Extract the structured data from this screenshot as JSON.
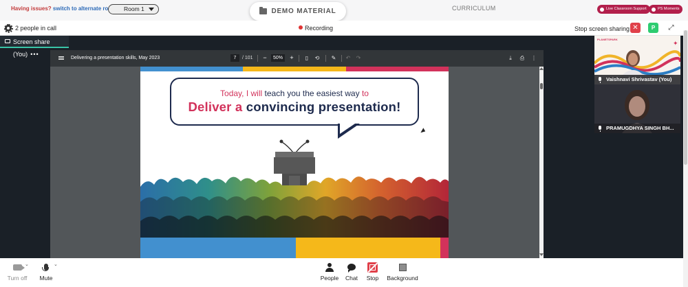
{
  "topbar": {
    "issues_text": "Having issues?",
    "alt_link": "switch to alternate room",
    "room_value": "Room 1",
    "demo_tab_label": "DEMO MATERIAL",
    "curriculum_label": "CURRICULUM",
    "live_support_label": "Live Classroom Support",
    "moments_label": "PS Moments"
  },
  "call": {
    "people_count": "2 people in call",
    "recording": "Recording",
    "stop_sharing": "Stop screen sharing",
    "close_glyph": "✕",
    "user_initial": "P",
    "expand_glyph": "⤢"
  },
  "share_tab": {
    "label": "Screen share (You)",
    "more": "•••"
  },
  "pdf": {
    "title": "Delivering a presentation skills, May 2023",
    "page_current": "7",
    "page_total": "/ 101",
    "zoom": "50%",
    "zoom_out": "−",
    "zoom_in": "+",
    "icons": {
      "fit": "▯",
      "rotate": "⟲",
      "annotate": "✎",
      "undo": "↶",
      "redo": "↷",
      "download": "⤓",
      "print": "⎙",
      "more": "⋮"
    }
  },
  "slide": {
    "line1_a": "Today, I will",
    "line1_b": "teach you the easiest way",
    "line1_c": "to",
    "line2_a": "Deliver a",
    "line2_b": "convincing presentation!",
    "colors": {
      "blue": "#4290cf",
      "yellow": "#f5b81a",
      "pink": "#d2325b",
      "navy": "#1d2a4d"
    }
  },
  "participants": [
    {
      "name": "Vaishnavi Shrivastav (You)",
      "logo_text": "PLANETSPARK",
      "spark": "✦"
    },
    {
      "name": "PRAMUGDHYA SINGH BH..."
    }
  ],
  "controls": {
    "turn_off": "Turn off",
    "mute": "Mute",
    "people": "People",
    "chat": "Chat",
    "stop": "Stop",
    "background": "Background",
    "chevron": "⌄"
  }
}
